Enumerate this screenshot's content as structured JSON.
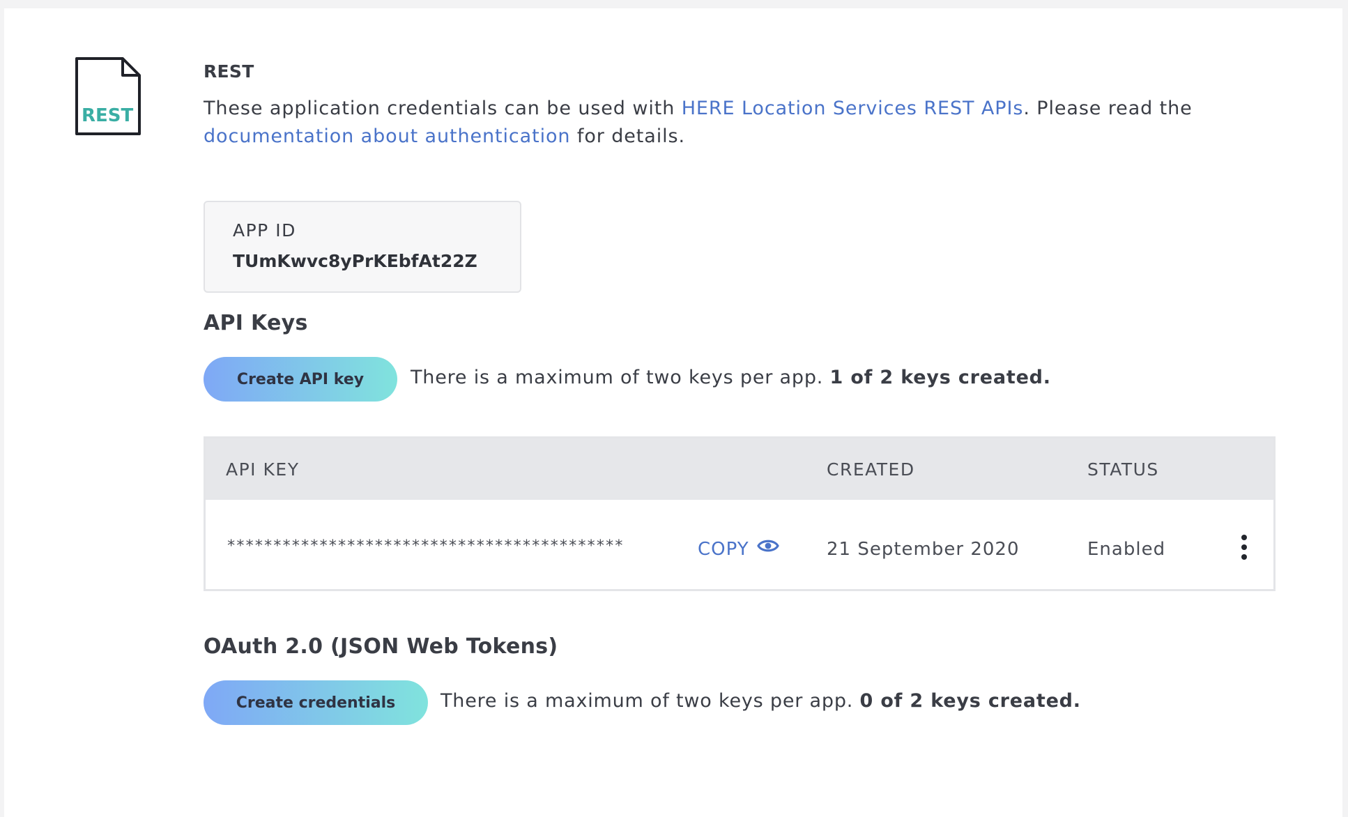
{
  "rest_section": {
    "icon_label": "REST",
    "title": "REST",
    "description": {
      "part1": "These application credentials can be used with ",
      "link1": "HERE Location Services REST APIs",
      "part2": ". Please read the ",
      "link2": "documentation about authentication",
      "part3": " for details."
    },
    "app_id": {
      "label": "APP ID",
      "value": "TUmKwvc8yPrKEbfAt22Z"
    }
  },
  "api_keys": {
    "heading": "API Keys",
    "create_button": "Create API key",
    "note": "There is a maximum of two keys per app. ",
    "note_bold": "1 of 2 keys created.",
    "table": {
      "columns": [
        "API KEY",
        "CREATED",
        "STATUS"
      ],
      "rows": [
        {
          "key": "*******************************************",
          "copy": "COPY",
          "created": "21 September 2020",
          "status": "Enabled"
        }
      ]
    }
  },
  "oauth": {
    "heading": "OAuth 2.0 (JSON Web Tokens)",
    "create_button": "Create credentials",
    "note": "There is a maximum of two keys per app. ",
    "note_bold": "0 of 2 keys created."
  },
  "colors": {
    "link": "#4a73c9",
    "icon_text": "#3aaea4",
    "button_gradient_start": "#7fa8f6",
    "button_gradient_end": "#80e3dd"
  },
  "icons": [
    "rest-file-icon",
    "eye-icon",
    "more-vertical-icon"
  ]
}
